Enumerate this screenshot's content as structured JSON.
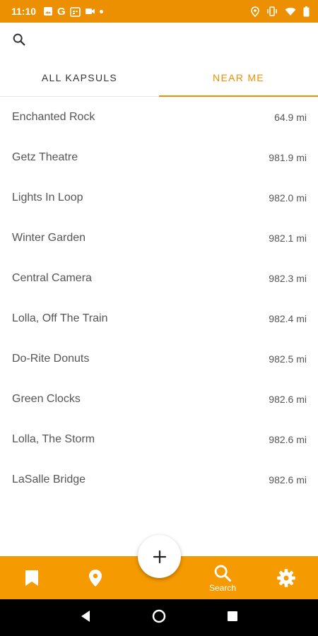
{
  "status_bar": {
    "time": "11:10",
    "left_icons": [
      "image-icon",
      "google-icon",
      "calendar-icon",
      "video-icon",
      "dot-icon"
    ],
    "google_glyph": "G",
    "right_icons": [
      "location-icon",
      "vibrate-icon",
      "wifi-icon",
      "battery-icon"
    ]
  },
  "search": {
    "icon": "search-icon"
  },
  "tabs": [
    {
      "label": "ALL KAPSULS",
      "active": false
    },
    {
      "label": "NEAR ME",
      "active": true
    }
  ],
  "places": [
    {
      "name": "Enchanted Rock",
      "distance": "64.9 mi"
    },
    {
      "name": "Getz Theatre",
      "distance": "981.9 mi"
    },
    {
      "name": "Lights In Loop",
      "distance": "982.0 mi"
    },
    {
      "name": "Winter Garden",
      "distance": "982.1 mi"
    },
    {
      "name": "Central Camera",
      "distance": "982.3 mi"
    },
    {
      "name": "Lolla, Off The Train",
      "distance": "982.4 mi"
    },
    {
      "name": "Do-Rite Donuts",
      "distance": "982.5 mi"
    },
    {
      "name": "Green Clocks",
      "distance": "982.6 mi"
    },
    {
      "name": "Lolla, The Storm",
      "distance": "982.6 mi"
    },
    {
      "name": "LaSalle Bridge",
      "distance": "982.6 mi"
    }
  ],
  "fab": {
    "icon": "plus-icon",
    "glyph": "+"
  },
  "bottom_nav": {
    "items": [
      {
        "icon": "bookmark-icon",
        "label": ""
      },
      {
        "icon": "map-pin-icon",
        "label": ""
      },
      {
        "icon": "search-icon",
        "label": "Search"
      },
      {
        "icon": "gear-icon",
        "label": ""
      }
    ]
  },
  "system_nav": {
    "icons": [
      "back-icon",
      "home-icon",
      "recents-icon"
    ]
  },
  "colors": {
    "accent": "#EC8F00",
    "bottom_nav": "#F59A00",
    "text": "#555555",
    "tab_inactive": "#333333"
  }
}
